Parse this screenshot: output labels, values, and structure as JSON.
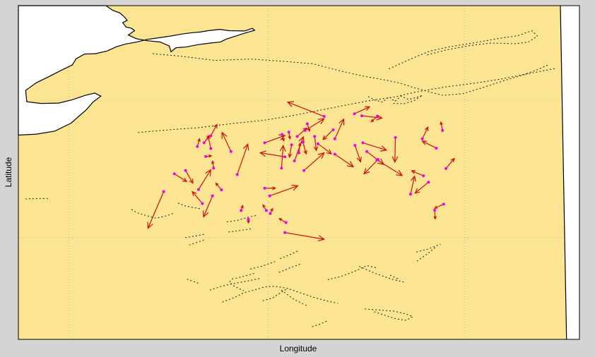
{
  "chart_data": {
    "type": "quiver",
    "title": "",
    "xlabel": "Longitude",
    "ylabel": "Latitude",
    "xlim": [
      0,
      100
    ],
    "ylim": [
      0,
      100
    ],
    "grid": "dotted",
    "colors": {
      "ocean": "#fbe492",
      "land": "#ffffff",
      "coastline": "#000000",
      "arrow": "#cc1111",
      "origin_marker": "#ee00ee",
      "figure_background": "#d4d4d4"
    },
    "vectors": [
      {
        "x": 25.9,
        "y": 44.3,
        "u": -2.8,
        "v": -11.0
      },
      {
        "x": 27.8,
        "y": 49.6,
        "u": 2.2,
        "v": -2.3
      },
      {
        "x": 29.8,
        "y": 50.6,
        "u": 1.3,
        "v": -3.8
      },
      {
        "x": 32.8,
        "y": 40.7,
        "u": -1.8,
        "v": 3.6
      },
      {
        "x": 32.1,
        "y": 44.9,
        "u": 2.2,
        "v": 5.9
      },
      {
        "x": 34.6,
        "y": 43.0,
        "u": -1.6,
        "v": -6.3
      },
      {
        "x": 34.3,
        "y": 57.2,
        "u": -0.5,
        "v": 3.8
      },
      {
        "x": 31.9,
        "y": 57.8,
        "u": 0.4,
        "v": 2.3
      },
      {
        "x": 33.4,
        "y": 54.8,
        "u": 1.0,
        "v": 0.2
      },
      {
        "x": 34.8,
        "y": 51.3,
        "u": -0.2,
        "v": 2.1
      },
      {
        "x": 37.9,
        "y": 56.3,
        "u": -1.6,
        "v": 5.7
      },
      {
        "x": 39.0,
        "y": 49.4,
        "u": 1.9,
        "v": 9.1
      },
      {
        "x": 33.1,
        "y": 58.9,
        "u": 0.9,
        "v": 2.1
      },
      {
        "x": 34.3,
        "y": 61.0,
        "u": 1.1,
        "v": 3.4
      },
      {
        "x": 39.7,
        "y": 38.6,
        "u": 0.3,
        "v": 1.5
      },
      {
        "x": 44.8,
        "y": 43.0,
        "u": 5.0,
        "v": 3.0
      },
      {
        "x": 44.2,
        "y": 38.6,
        "u": -0.6,
        "v": 1.7
      },
      {
        "x": 44.9,
        "y": 37.7,
        "u": 0.4,
        "v": 1.5
      },
      {
        "x": 43.9,
        "y": 45.3,
        "u": 1.9,
        "v": 0.0
      },
      {
        "x": 47.5,
        "y": 32.0,
        "u": 7.0,
        "v": -2.0
      },
      {
        "x": 43.9,
        "y": 58.9,
        "u": 3.6,
        "v": 2.2
      },
      {
        "x": 47.5,
        "y": 54.7,
        "u": -4.4,
        "v": 1.2
      },
      {
        "x": 46.9,
        "y": 51.3,
        "u": 0.3,
        "v": 6.8
      },
      {
        "x": 48.7,
        "y": 58.3,
        "u": -0.4,
        "v": -3.7
      },
      {
        "x": 49.2,
        "y": 53.5,
        "u": 1.6,
        "v": 7.2
      },
      {
        "x": 50.0,
        "y": 55.9,
        "u": 0.2,
        "v": 2.8
      },
      {
        "x": 50.7,
        "y": 59.1,
        "u": 0.6,
        "v": -3.5
      },
      {
        "x": 47.0,
        "y": 61.4,
        "u": 0.3,
        "v": -1.9
      },
      {
        "x": 48.2,
        "y": 62.1,
        "u": 0.2,
        "v": -2.0
      },
      {
        "x": 49.7,
        "y": 60.8,
        "u": 1.7,
        "v": 2.5
      },
      {
        "x": 51.1,
        "y": 62.6,
        "u": 3.4,
        "v": 3.5
      },
      {
        "x": 51.5,
        "y": 64.6,
        "u": 0.4,
        "v": -2.2
      },
      {
        "x": 54.5,
        "y": 66.8,
        "u": -6.5,
        "v": 4.3
      },
      {
        "x": 52.8,
        "y": 60.8,
        "u": 0.3,
        "v": -4.2
      },
      {
        "x": 53.4,
        "y": 58.6,
        "u": 2.4,
        "v": -3.0
      },
      {
        "x": 50.9,
        "y": 50.6,
        "u": 3.6,
        "v": 5.3
      },
      {
        "x": 56.1,
        "y": 62.8,
        "u": -1.8,
        "v": -2.9
      },
      {
        "x": 56.4,
        "y": 60.1,
        "u": 1.6,
        "v": 5.9
      },
      {
        "x": 56.4,
        "y": 55.5,
        "u": 3.3,
        "v": -3.8
      },
      {
        "x": 59.9,
        "y": 67.6,
        "u": 2.7,
        "v": 2.1
      },
      {
        "x": 61.2,
        "y": 67.0,
        "u": 3.6,
        "v": -0.7
      },
      {
        "x": 64.0,
        "y": 66.9,
        "u": -1.1,
        "v": -1.7
      },
      {
        "x": 60.0,
        "y": 58.1,
        "u": 1.0,
        "v": -4.9
      },
      {
        "x": 61.4,
        "y": 58.9,
        "u": 4.2,
        "v": -2.2
      },
      {
        "x": 62.1,
        "y": 56.3,
        "u": 3.0,
        "v": -3.9
      },
      {
        "x": 64.1,
        "y": 53.9,
        "u": -2.5,
        "v": -4.3
      },
      {
        "x": 63.9,
        "y": 53.8,
        "u": 4.5,
        "v": -4.7
      },
      {
        "x": 67.2,
        "y": 60.5,
        "u": -0.1,
        "v": -7.4
      },
      {
        "x": 72.0,
        "y": 60.1,
        "u": 1.0,
        "v": 3.5
      },
      {
        "x": 74.5,
        "y": 57.3,
        "u": -2.5,
        "v": 2.1
      },
      {
        "x": 75.6,
        "y": 62.6,
        "u": -0.3,
        "v": 2.5
      },
      {
        "x": 72.2,
        "y": 49.0,
        "u": -2.1,
        "v": 1.5
      },
      {
        "x": 73.1,
        "y": 47.1,
        "u": -2.4,
        "v": -3.3
      },
      {
        "x": 69.9,
        "y": 43.5,
        "u": 0.7,
        "v": 5.4
      },
      {
        "x": 76.2,
        "y": 51.2,
        "u": 1.5,
        "v": 3.0
      },
      {
        "x": 75.8,
        "y": 40.5,
        "u": -1.6,
        "v": -1.2
      },
      {
        "x": 74.2,
        "y": 38.7,
        "u": 0.1,
        "v": -2.6
      },
      {
        "x": 47.7,
        "y": 35.0,
        "u": -1.2,
        "v": 1.2
      },
      {
        "x": 36.2,
        "y": 44.8,
        "u": -1.0,
        "v": 2.0
      },
      {
        "x": 41.0,
        "y": 36.0,
        "u": 0.0,
        "v": -1.1
      }
    ],
    "coastline_paths": [
      [
        [
          15.6,
          100
        ],
        [
          16.8,
          98.6
        ],
        [
          18.1,
          97.8
        ],
        [
          18.9,
          96.6
        ],
        [
          19.4,
          95.6
        ],
        [
          18.6,
          94.9
        ],
        [
          19.2,
          93.6
        ],
        [
          20.2,
          93.2
        ],
        [
          20.7,
          92.5
        ],
        [
          19.6,
          91.2
        ],
        [
          21.0,
          90.1
        ],
        [
          23.0,
          89.5
        ],
        [
          25.3,
          89.1
        ],
        [
          26.9,
          87.9
        ],
        [
          27.2,
          86.2
        ],
        [
          28.1,
          87.4
        ],
        [
          29.8,
          87.6
        ],
        [
          32.0,
          88.3
        ],
        [
          34.2,
          88.8
        ],
        [
          36.0,
          89.1
        ],
        [
          37.1,
          90.0
        ],
        [
          40.2,
          91.7
        ],
        [
          42.1,
          92.6
        ],
        [
          41.7,
          93.2
        ],
        [
          40.3,
          92.4
        ],
        [
          37.6,
          92.5
        ],
        [
          35.9,
          92.9
        ],
        [
          33.8,
          92.5
        ],
        [
          32.4,
          92.1
        ],
        [
          31.0,
          91.9
        ],
        [
          29.2,
          91.5
        ],
        [
          27.2,
          90.9
        ],
        [
          25.6,
          90.5
        ],
        [
          23.0,
          89.9
        ],
        [
          21.1,
          89.1
        ],
        [
          19.1,
          88.5
        ],
        [
          17.5,
          87.7
        ],
        [
          15.8,
          86.4
        ],
        [
          13.7,
          85.6
        ],
        [
          11.8,
          85.5
        ],
        [
          10.3,
          84.1
        ],
        [
          9.6,
          82.2
        ],
        [
          7.6,
          80.6
        ],
        [
          5.3,
          78.6
        ],
        [
          3.2,
          76.9
        ],
        [
          1.3,
          74.6
        ],
        [
          1.5,
          71.2
        ],
        [
          4.0,
          70.7
        ],
        [
          7.2,
          70.8
        ],
        [
          9.6,
          71.8
        ],
        [
          11.9,
          73.1
        ],
        [
          13.6,
          73.8
        ],
        [
          14.7,
          72.9
        ],
        [
          13.3,
          71.1
        ],
        [
          12.1,
          68.8
        ],
        [
          9.4,
          64.8
        ],
        [
          6.5,
          62.4
        ],
        [
          3.2,
          61.5
        ],
        [
          0,
          61.2
        ]
      ],
      [
        [
          96.6,
          100
        ],
        [
          97.7,
          0
        ]
      ]
    ],
    "dotted_tracks": [
      [
        [
          21.4,
          62.0
        ],
        [
          26.8,
          62.8
        ],
        [
          32.0,
          63.4
        ],
        [
          37.8,
          64.6
        ],
        [
          43.5,
          65.6
        ],
        [
          48.1,
          66.8
        ],
        [
          53.6,
          68.6
        ],
        [
          58.6,
          70.3
        ],
        [
          63.5,
          71.8
        ],
        [
          66.7,
          72.5
        ],
        [
          70.8,
          74.1
        ],
        [
          76.4,
          75.7
        ],
        [
          81.5,
          76.8
        ],
        [
          86.0,
          78.0
        ],
        [
          89.9,
          79.3
        ],
        [
          95.5,
          81.1
        ]
      ],
      [
        [
          24.0,
          85.6
        ],
        [
          29.2,
          84.8
        ],
        [
          35.0,
          83.6
        ],
        [
          41.4,
          84.0
        ],
        [
          47.3,
          83.3
        ],
        [
          52.4,
          82.6
        ],
        [
          57.2,
          80.5
        ],
        [
          61.4,
          78.9
        ],
        [
          64.5,
          78.0
        ],
        [
          67.8,
          76.9
        ],
        [
          70.4,
          75.5
        ],
        [
          72.7,
          74.4
        ],
        [
          75.7,
          73.1
        ],
        [
          79.1,
          73.6
        ],
        [
          82.7,
          75.4
        ],
        [
          86.5,
          77.5
        ],
        [
          89.6,
          79.0
        ],
        [
          92.3,
          80.7
        ],
        [
          94.5,
          82.3
        ]
      ],
      [
        [
          66.1,
          81.1
        ],
        [
          69.9,
          84.0
        ],
        [
          73.2,
          86.3
        ],
        [
          76.9,
          87.7
        ],
        [
          81.0,
          88.8
        ],
        [
          85.7,
          90.2
        ],
        [
          89.0,
          91.0
        ],
        [
          91.5,
          92.5
        ],
        [
          92.5,
          90.9
        ],
        [
          90.9,
          89.1
        ],
        [
          88.6,
          88.6
        ],
        [
          84.2,
          88.8
        ],
        [
          80.3,
          88.0
        ],
        [
          76.2,
          86.7
        ],
        [
          72.5,
          85.1
        ]
      ],
      [
        [
          62.4,
          72.7
        ],
        [
          63.6,
          71.7
        ],
        [
          64.9,
          71.1
        ],
        [
          66.1,
          72.7
        ],
        [
          67.1,
          71.3
        ],
        [
          68.2,
          72.9
        ],
        [
          69.5,
          71.9
        ],
        [
          70.8,
          72.4
        ],
        [
          72.0,
          73.1
        ],
        [
          70.5,
          71.5
        ],
        [
          68.7,
          70.6
        ],
        [
          66.9,
          70.7
        ]
      ],
      [
        [
          1.3,
          42.1
        ],
        [
          3.6,
          42.2
        ],
        [
          5.4,
          42.2
        ]
      ],
      [
        [
          20.2,
          38.9
        ],
        [
          21.2,
          37.9
        ],
        [
          22.8,
          37.1
        ],
        [
          24.6,
          36.3
        ],
        [
          26.3,
          37.0
        ],
        [
          27.5,
          37.7
        ]
      ],
      [
        [
          28.5,
          40.8
        ],
        [
          29.7,
          40.0
        ],
        [
          31.2,
          39.5
        ],
        [
          32.3,
          39.2
        ]
      ],
      [
        [
          37.2,
          35.2
        ],
        [
          38.9,
          35.6
        ],
        [
          40.7,
          36.5
        ],
        [
          42.6,
          37.2
        ]
      ],
      [
        [
          37.5,
          32.2
        ],
        [
          39.5,
          32.6
        ],
        [
          41.4,
          33.1
        ]
      ],
      [
        [
          29.8,
          30.5
        ],
        [
          31.6,
          31.0
        ],
        [
          33.5,
          31.6
        ]
      ],
      [
        [
          30.5,
          28.3
        ],
        [
          31.9,
          29.1
        ],
        [
          33.0,
          29.7
        ]
      ],
      [
        [
          46.7,
          24.2
        ],
        [
          48.4,
          25.4
        ],
        [
          49.8,
          26.5
        ]
      ],
      [
        [
          46.5,
          20.1
        ],
        [
          48.5,
          21.5
        ],
        [
          50.3,
          22.6
        ]
      ],
      [
        [
          41.4,
          21.1
        ],
        [
          43.4,
          21.9
        ],
        [
          45.7,
          23.3
        ]
      ],
      [
        [
          38.8,
          18.3
        ],
        [
          40.6,
          19.1
        ],
        [
          42.1,
          19.8
        ]
      ],
      [
        [
          30.1,
          18.0
        ],
        [
          31.4,
          17.2
        ],
        [
          32.4,
          16.6
        ]
      ],
      [
        [
          34.2,
          14.8
        ],
        [
          36.2,
          15.9
        ],
        [
          38.3,
          16.7
        ],
        [
          40.6,
          17.4
        ],
        [
          42.9,
          18.2
        ]
      ],
      [
        [
          36.4,
          11.2
        ],
        [
          38.6,
          12.6
        ],
        [
          40.1,
          13.9
        ],
        [
          41.8,
          14.7
        ],
        [
          43.9,
          15.7
        ],
        [
          45.7,
          15.9
        ],
        [
          47.9,
          15.3
        ],
        [
          50.5,
          13.8
        ],
        [
          52.8,
          12.5
        ],
        [
          54.8,
          11.6
        ],
        [
          56.9,
          10.8
        ]
      ],
      [
        [
          38.2,
          18.2
        ],
        [
          37.6,
          17.1
        ],
        [
          38.5,
          15.9
        ],
        [
          40.1,
          14.6
        ]
      ],
      [
        [
          43.6,
          11.6
        ],
        [
          45.2,
          12.3
        ],
        [
          46.6,
          13.8
        ],
        [
          47.8,
          15.1
        ]
      ],
      [
        [
          46.9,
          14.7
        ],
        [
          49.2,
          11.9
        ],
        [
          51.4,
          10.1
        ]
      ],
      [
        [
          55.2,
          17.9
        ],
        [
          57.6,
          18.9
        ],
        [
          60.2,
          20.6
        ],
        [
          62.1,
          22.1
        ],
        [
          63.9,
          21.4
        ]
      ],
      [
        [
          60.8,
          21.8
        ],
        [
          63.7,
          19.7
        ],
        [
          66.2,
          18.2
        ],
        [
          68.8,
          17.1
        ]
      ],
      [
        [
          66.3,
          19.2
        ],
        [
          67.7,
          18.1
        ]
      ],
      [
        [
          71.1,
          23.5
        ],
        [
          72.8,
          25.5
        ],
        [
          74.6,
          27.9
        ]
      ],
      [
        [
          71.0,
          26.2
        ],
        [
          73.1,
          27.1
        ],
        [
          75.2,
          28.5
        ]
      ],
      [
        [
          61.8,
          9.1
        ],
        [
          64.2,
          8.8
        ],
        [
          66.8,
          8.5
        ],
        [
          68.9,
          7.7
        ],
        [
          70.3,
          6.8
        ],
        [
          69.1,
          5.7
        ],
        [
          67.2,
          6.2
        ],
        [
          65.3,
          7.2
        ],
        [
          63.4,
          8.3
        ]
      ],
      [
        [
          52.4,
          3.8
        ],
        [
          53.8,
          4.6
        ],
        [
          55.3,
          5.7
        ]
      ]
    ]
  }
}
